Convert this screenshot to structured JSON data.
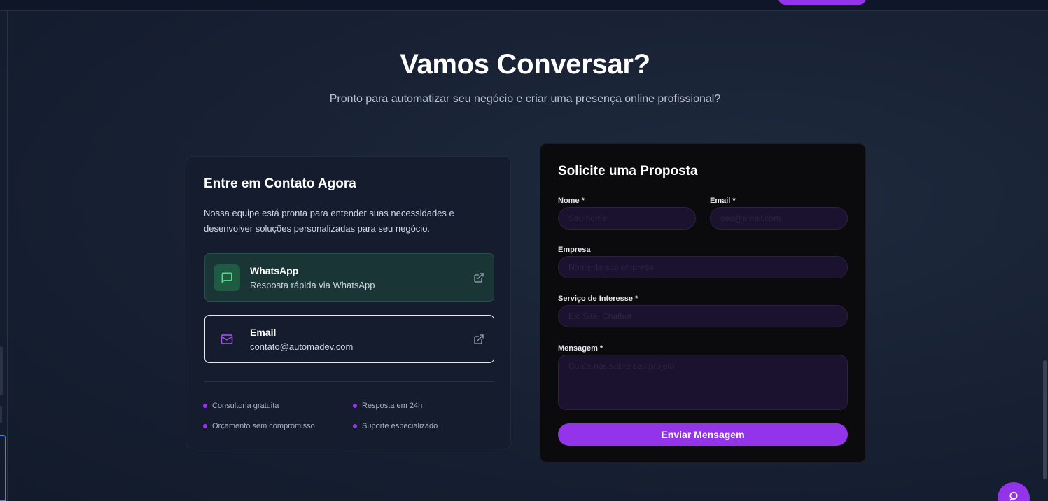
{
  "header": {
    "title": "Vamos Conversar?",
    "subtitle": "Pronto para automatizar seu negócio e criar uma presença online profissional?"
  },
  "contact": {
    "title": "Entre em Contato Agora",
    "description": "Nossa equipe está pronta para entender suas necessidades e desenvolver soluções personalizadas para seu negócio.",
    "whatsapp": {
      "title": "WhatsApp",
      "subtitle": "Resposta rápida via WhatsApp",
      "icon": "message-square-icon"
    },
    "email": {
      "title": "Email",
      "subtitle": "contato@automadev.com",
      "icon": "mail-icon"
    },
    "features": [
      "Consultoria gratuita",
      "Resposta em 24h",
      "Orçamento sem compromisso",
      "Suporte especializado"
    ]
  },
  "form": {
    "title": "Solicite uma Proposta",
    "name_label": "Nome *",
    "name_placeholder": "Seu nome",
    "email_label": "Email *",
    "email_placeholder": "seu@email.com",
    "company_label": "Empresa",
    "company_placeholder": "Nome da sua empresa",
    "service_label": "Serviço de Interesse *",
    "service_placeholder": "Ex: Site, Chatbot",
    "message_label": "Mensagem *",
    "message_placeholder": "Conte-nos sobre seu projeto",
    "submit_label": "Enviar Mensagem"
  },
  "colors": {
    "accent": "#9333ea",
    "form_bg": "#0b0b0d",
    "card_bg": "#141c2d",
    "whatsapp_bg": "#1a3536"
  }
}
